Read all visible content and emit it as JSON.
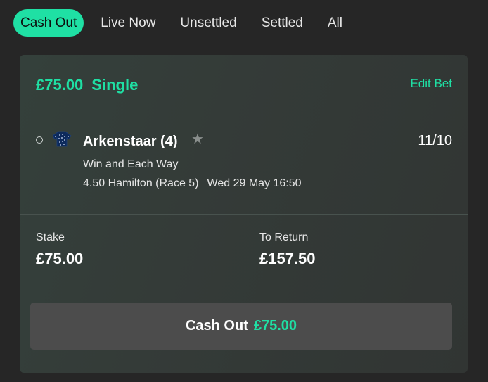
{
  "tabs": [
    {
      "label": "Cash Out",
      "active": true
    },
    {
      "label": "Live Now",
      "active": false
    },
    {
      "label": "Unsettled",
      "active": false
    },
    {
      "label": "Settled",
      "active": false
    },
    {
      "label": "All",
      "active": false
    }
  ],
  "bet": {
    "stake_title": "£75.00",
    "type": "Single",
    "edit_label": "Edit Bet",
    "selection": {
      "runner": "Arkenstaar (4)",
      "odds": "11/10",
      "market": "Win and Each Way",
      "race": "4.50 Hamilton (Race 5)",
      "datetime": "Wed 29 May 16:50",
      "silks_icon": "jockey-silks-icon",
      "favourite_icon": "star-icon"
    },
    "stake_label": "Stake",
    "stake_value": "£75.00",
    "return_label": "To Return",
    "return_value": "£157.50",
    "cashout": {
      "label": "Cash Out",
      "amount": "£75.00"
    }
  },
  "colors": {
    "accent": "#1fe0a4",
    "background": "#262626",
    "card": "#343b38",
    "button": "#4c4c4c"
  }
}
